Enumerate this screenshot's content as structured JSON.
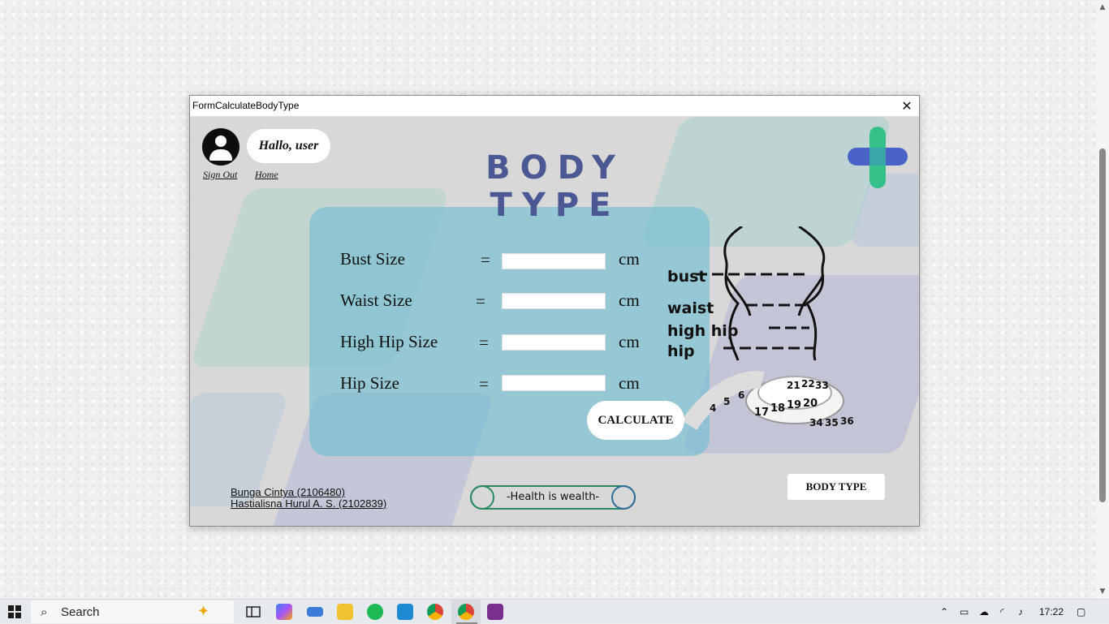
{
  "window": {
    "title": "FormCalculateBodyType",
    "close_glyph": "✕"
  },
  "header": {
    "greeting": "Hallo, user",
    "sign_out": "Sign Out",
    "home": "Home",
    "page_title": "BODY TYPE"
  },
  "form": {
    "rows": [
      {
        "label": "Bust Size",
        "eq": "=",
        "value": "",
        "unit": "cm"
      },
      {
        "label": "Waist Size",
        "eq": "=",
        "value": "",
        "unit": "cm"
      },
      {
        "label": "High Hip Size",
        "eq": "=",
        "value": "",
        "unit": "cm"
      },
      {
        "label": "Hip Size",
        "eq": "=",
        "value": "",
        "unit": "cm"
      }
    ],
    "calculate_label": "CALCULATE"
  },
  "illustration": {
    "labels": [
      "bust",
      "waist",
      "high hip",
      "hip"
    ],
    "tape_numbers": [
      "4",
      "5",
      "6",
      "17",
      "18",
      "19",
      "20",
      "21",
      "22",
      "33",
      "34",
      "35",
      "36"
    ]
  },
  "footer": {
    "authors": [
      "Bunga Cintya (2106480)",
      "Hastialisna Hurul A. S. (2102839)"
    ],
    "motto": "-Health is wealth-",
    "body_type_button": "BODY TYPE"
  },
  "taskbar": {
    "search_label": "Search",
    "time": "17:22",
    "apps": [
      "task-view",
      "copilot",
      "keyboard",
      "file-explorer",
      "spotify",
      "vscode",
      "chrome",
      "chrome-active",
      "winrar"
    ]
  },
  "colors": {
    "title": "#4b5894",
    "panel": "#73bed2",
    "logo_green": "#35c08a",
    "logo_blue": "#4a63c9"
  }
}
